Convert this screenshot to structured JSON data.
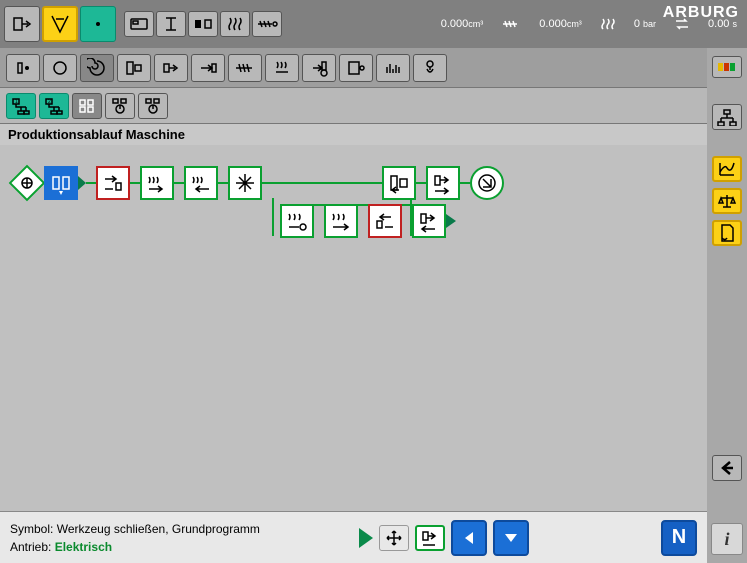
{
  "brand": "ARBURG",
  "top_readouts": {
    "r1_value": "0.000",
    "r1_unit": "cm³",
    "r2_value": "0.000",
    "r2_unit": "cm³",
    "r3_value": "0",
    "r3_unit": "bar",
    "r4_value": "0.00",
    "r4_unit": "s"
  },
  "page_title": "Produktionsablauf Maschine",
  "status": {
    "symbol_label": "Symbol:",
    "symbol_value": "Werkzeug schließen, Grundprogramm",
    "drive_label": "Antrieb:",
    "drive_value": "Elektrisch"
  },
  "nav_n": "N",
  "flow_nodes": {
    "start": "start-diamond",
    "close_mold": "mold-close",
    "nozzle_fwd": "nozzle-forward",
    "injection": "injection",
    "hold": "hold-pressure",
    "cool": "cooling",
    "eject_back": "ejector-back",
    "eject_fwd": "ejector-forward",
    "end": "cycle-end",
    "branch_a": "dosing",
    "branch_b": "decompression",
    "branch_c": "nozzle-back",
    "branch_d": "merge"
  }
}
